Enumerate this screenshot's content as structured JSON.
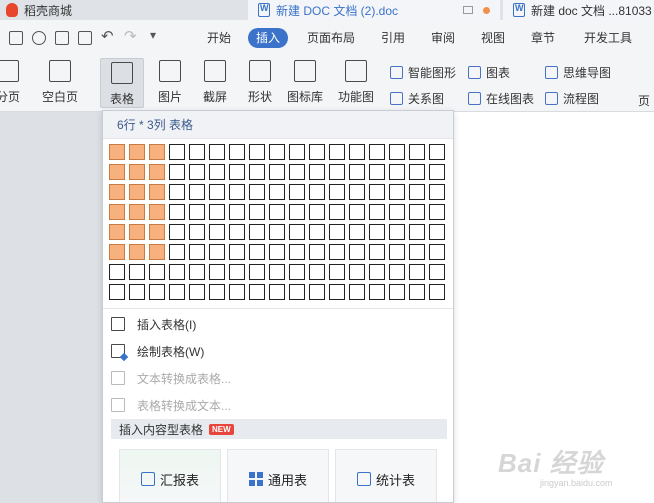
{
  "titlebar": {
    "shop_tab": "稻壳商城",
    "doc_tab": "新建 DOC 文档 (2).doc",
    "doc_tab2": "新建 doc 文档 ...81033"
  },
  "menu": [
    "开始",
    "插入",
    "页面布局",
    "引用",
    "审阅",
    "视图",
    "章节",
    "开发工具"
  ],
  "active_menu": "插入",
  "ribbon": {
    "big_tools": [
      "分页",
      "空白页",
      "表格",
      "图片",
      "截屏",
      "形状",
      "图标库",
      "功能图"
    ],
    "small_tools_col1": [
      "智能图形",
      "关系图"
    ],
    "small_tools_col2": [
      "图表",
      "在线图表"
    ],
    "small_tools_col3": [
      "思维导图",
      "流程图"
    ],
    "right_cut": "页"
  },
  "panel": {
    "header": "6行 * 3列 表格",
    "grid_rows": 8,
    "grid_cols": 17,
    "selected_rows": 6,
    "selected_cols": 3,
    "items": [
      {
        "label": "插入表格(I)",
        "disabled": false
      },
      {
        "label": "绘制表格(W)",
        "disabled": false
      },
      {
        "label": "文本转换成表格...",
        "disabled": true
      },
      {
        "label": "表格转换成文本...",
        "disabled": true
      }
    ],
    "section_title": "插入内容型表格",
    "badge": "NEW",
    "content_tables": [
      "汇报表",
      "通用表",
      "统计表"
    ]
  },
  "watermark": {
    "text": "Bai 经验",
    "sub": "jingyan.baidu.com"
  }
}
